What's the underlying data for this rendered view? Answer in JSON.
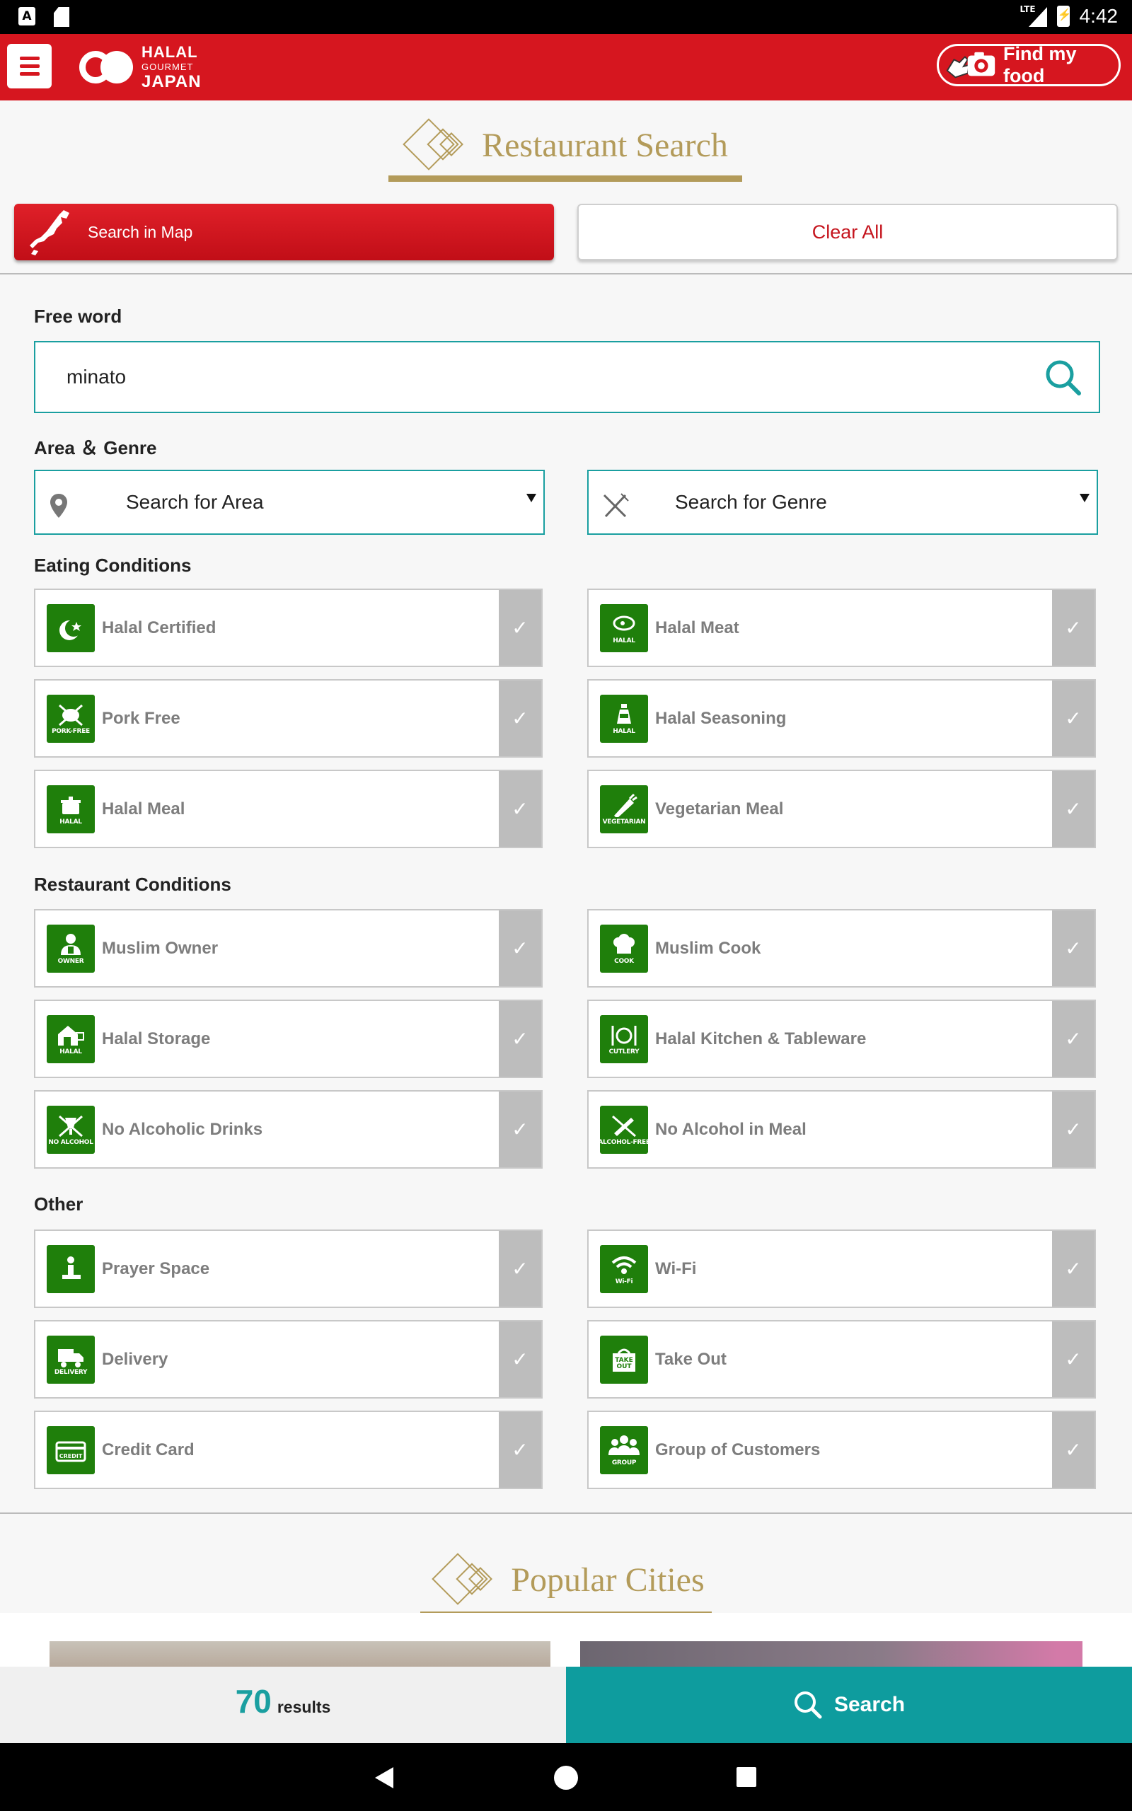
{
  "status_bar": {
    "time": "4:42",
    "network": "LTE",
    "left_icon_a": "A"
  },
  "header": {
    "logo": {
      "line1": "HALAL",
      "line2": "GOURMET",
      "line3": "JAPAN"
    },
    "find_food_label": "Find my food",
    "brand_color": "#d6161f"
  },
  "restaurant_search": {
    "title": "Restaurant Search",
    "map_button_label": "Search in Map",
    "clear_button_label": "Clear All",
    "free_word_label": "Free word",
    "free_word_value": "minato",
    "area_genre_label": "Area ＆ Genre",
    "area_placeholder": "Search for Area",
    "genre_placeholder": "Search for Genre"
  },
  "eating_conditions": {
    "label": "Eating Conditions",
    "items": [
      {
        "name": "Halal Certified",
        "icon": "crescent-star-icon",
        "caption": ""
      },
      {
        "name": "Halal Meat",
        "icon": "meat-icon",
        "caption": "HALAL"
      },
      {
        "name": "Pork Free",
        "icon": "pig-crossed-icon",
        "caption": "PORK-FREE"
      },
      {
        "name": "Halal Seasoning",
        "icon": "seasoning-bottle-icon",
        "caption": "HALAL"
      },
      {
        "name": "Halal Meal",
        "icon": "cooking-pot-icon",
        "caption": "HALAL"
      },
      {
        "name": "Vegetarian Meal",
        "icon": "carrot-icon",
        "caption": "VEGETARIAN"
      }
    ]
  },
  "restaurant_conditions": {
    "label": "Restaurant Conditions",
    "items": [
      {
        "name": "Muslim Owner",
        "icon": "owner-icon",
        "caption": "OWNER"
      },
      {
        "name": "Muslim Cook",
        "icon": "chef-hat-icon",
        "caption": "COOK"
      },
      {
        "name": "Halal Storage",
        "icon": "storage-icon",
        "caption": "HALAL"
      },
      {
        "name": "Halal Kitchen & Tableware",
        "icon": "cutlery-icon",
        "caption": "CUTLERY"
      },
      {
        "name": "No Alcoholic Drinks",
        "icon": "no-alcohol-icon",
        "caption": "NO ALCOHOL"
      },
      {
        "name": "No Alcohol in Meal",
        "icon": "alcohol-free-icon",
        "caption": "ALCOHOL-FREE"
      }
    ]
  },
  "other": {
    "label": "Other",
    "items": [
      {
        "name": "Prayer Space",
        "icon": "prayer-icon",
        "caption": ""
      },
      {
        "name": "Wi-Fi",
        "icon": "wifi-icon",
        "caption": "Wi-Fi"
      },
      {
        "name": "Delivery",
        "icon": "delivery-truck-icon",
        "caption": "DELIVERY"
      },
      {
        "name": "Take Out",
        "icon": "takeout-bag-icon",
        "caption": ""
      },
      {
        "name": "Credit Card",
        "icon": "credit-card-icon",
        "caption": ""
      },
      {
        "name": "Group of Customers",
        "icon": "group-icon",
        "caption": "GROUP"
      }
    ]
  },
  "popular_cities": {
    "title": "Popular Cities"
  },
  "bottom_bar": {
    "results_count": "70",
    "results_word": "results",
    "search_label": "Search"
  },
  "colors": {
    "teal": "#0e9c9e",
    "gold": "#b39b5a",
    "icon_green": "#1f7f0b",
    "check_gray": "#bdbdbd"
  }
}
